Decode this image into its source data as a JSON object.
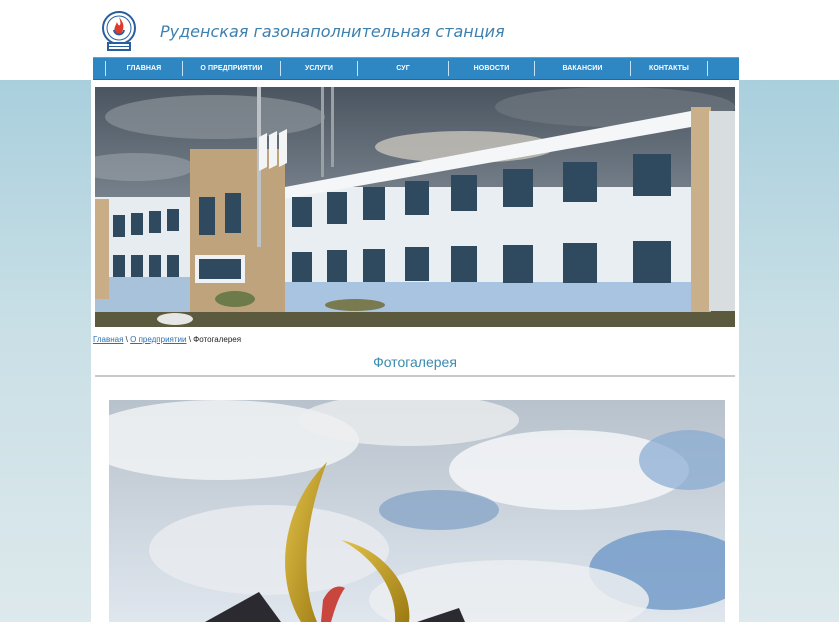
{
  "header": {
    "logo_alt": "логотип",
    "site_title": "Руденская газонаполнительная станция"
  },
  "nav": {
    "items": [
      {
        "label": "ГЛАВНАЯ"
      },
      {
        "label": "О ПРЕДПРИЯТИИ"
      },
      {
        "label": "УСЛУГИ"
      },
      {
        "label": "СУГ"
      },
      {
        "label": "НОВОСТИ"
      },
      {
        "label": "ВАКАНСИИ"
      },
      {
        "label": "КОНТАКТЫ"
      }
    ]
  },
  "breadcrumb": {
    "home": "Главная",
    "section": "О предприятии",
    "current": "Фотогалерея",
    "separator": " \\ "
  },
  "page": {
    "title": "Фотогалерея"
  },
  "colors": {
    "nav_bg": "#2e86c2",
    "title": "#3b8bb0",
    "site_title": "#3d7fae",
    "link": "#2f6fb0"
  }
}
